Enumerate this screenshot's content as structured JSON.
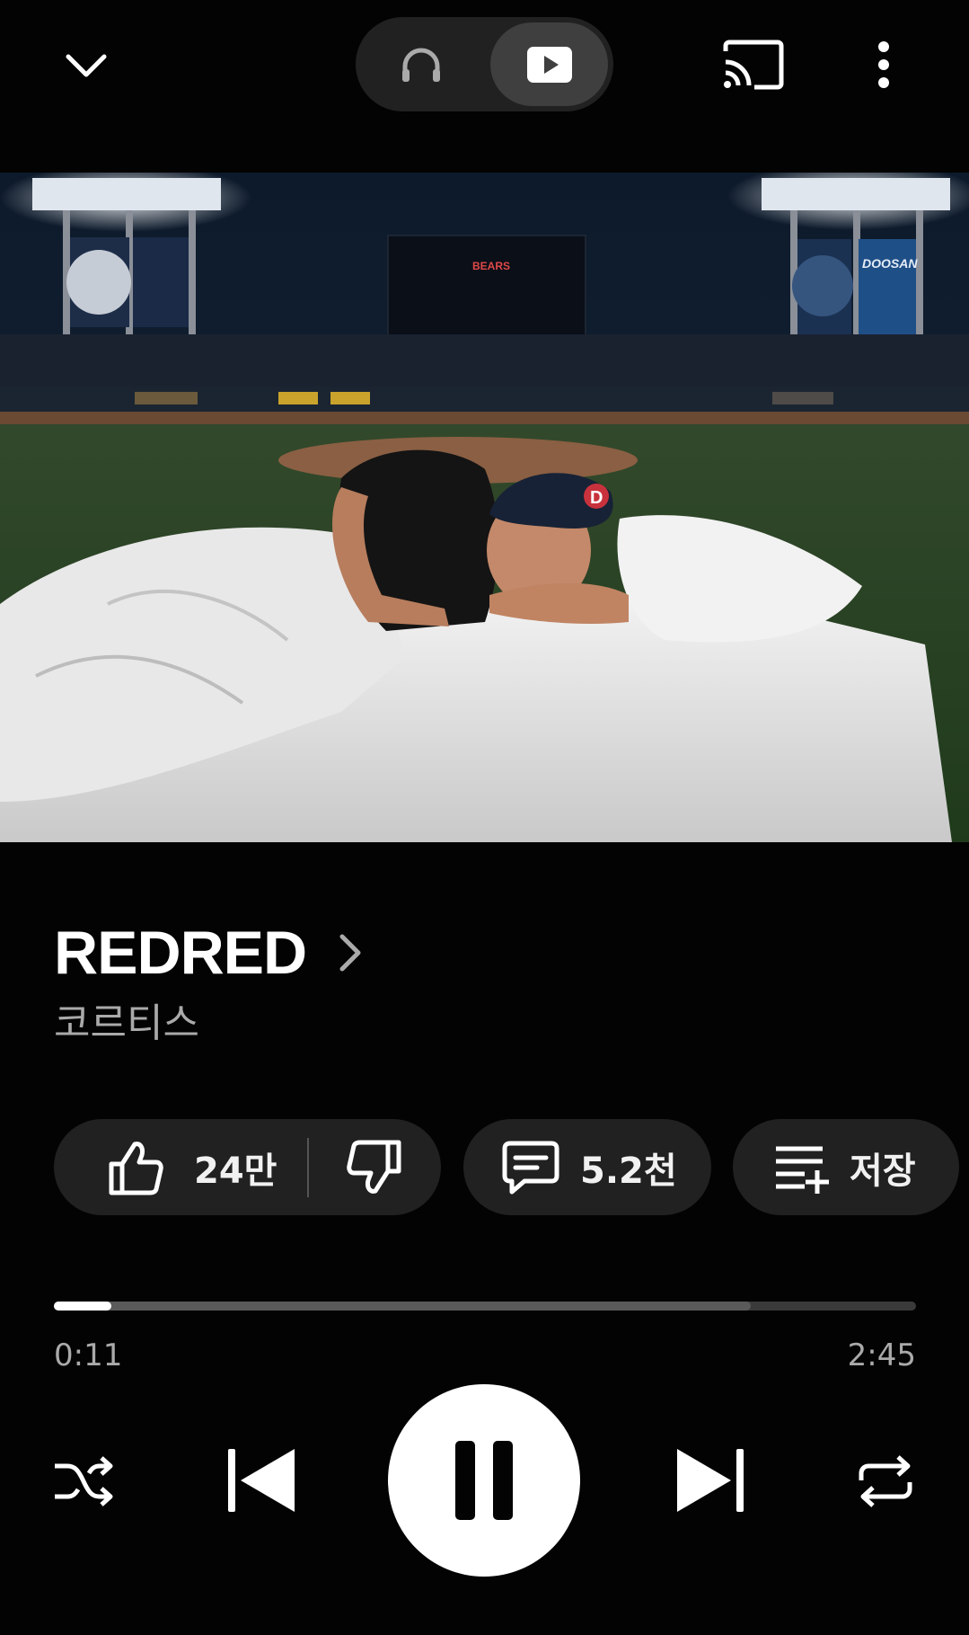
{
  "topbar": {
    "collapse_icon": "chevron-down-icon",
    "mode_options": [
      {
        "name": "audio",
        "icon": "headphones-icon",
        "selected": false
      },
      {
        "name": "video",
        "icon": "play-box-icon",
        "selected": true
      }
    ],
    "cast_icon": "cast-icon",
    "more_icon": "more-vert-icon"
  },
  "artwork": {
    "stadium_sign": "BEARS",
    "brand_sign": "DOOSAN",
    "cap_letter": "D"
  },
  "track": {
    "title": "REDRED",
    "artist": "코르티스"
  },
  "actions": {
    "like_count": "24만",
    "comment_count": "5.2천",
    "save_label": "저장"
  },
  "progress": {
    "current_time": "0:11",
    "total_time": "2:45",
    "played_fraction": 0.067,
    "buffered_fraction": 0.808
  },
  "controls": {
    "shuffle_icon": "shuffle-icon",
    "previous_icon": "skip-previous-icon",
    "playpause_icon": "pause-icon",
    "next_icon": "skip-next-icon",
    "repeat_icon": "repeat-icon"
  },
  "colors": {
    "background": "#030303",
    "pill": "#212121",
    "secondary_text": "#aaaaaa",
    "accent": "#ffffff"
  }
}
